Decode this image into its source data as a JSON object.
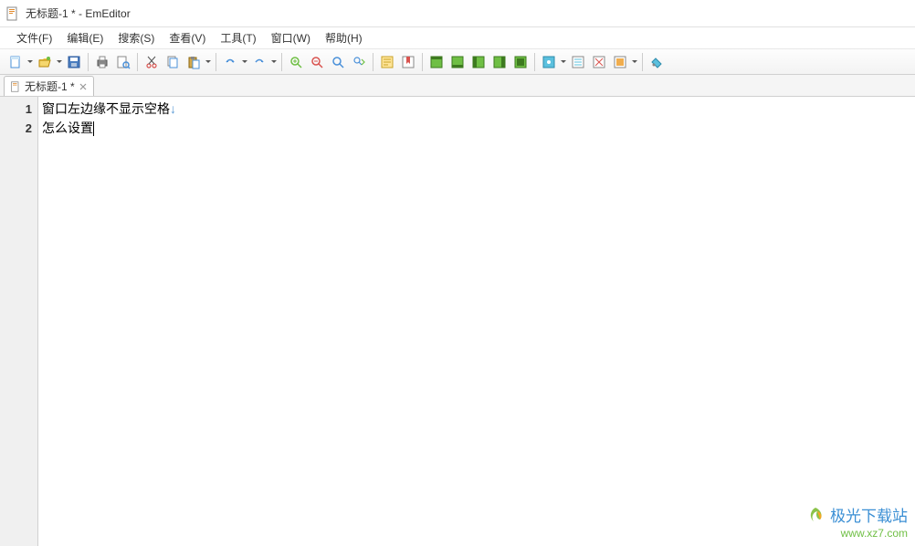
{
  "window": {
    "title": "无标题-1 * - EmEditor"
  },
  "menubar": {
    "items": [
      {
        "label": "文件(F)"
      },
      {
        "label": "编辑(E)"
      },
      {
        "label": "搜索(S)"
      },
      {
        "label": "查看(V)"
      },
      {
        "label": "工具(T)"
      },
      {
        "label": "窗口(W)"
      },
      {
        "label": "帮助(H)"
      }
    ]
  },
  "toolbar": {
    "icons": {
      "new": "new-file-icon",
      "open": "open-folder-icon",
      "save": "save-icon",
      "print": "print-icon",
      "preview": "print-preview-icon",
      "cut": "cut-icon",
      "copy": "copy-icon",
      "paste": "paste-icon",
      "undo": "undo-icon",
      "redo": "redo-icon",
      "zoomin": "zoom-in-icon",
      "zoomout": "zoom-out-icon",
      "find": "find-icon",
      "findnext": "find-next-icon",
      "wrap": "word-wrap-icon"
    }
  },
  "tabbar": {
    "tabs": [
      {
        "label": "无标题-1 *"
      }
    ]
  },
  "editor": {
    "lines": [
      {
        "num": "1",
        "text": "窗口左边缘不显示空格",
        "eol": "↓"
      },
      {
        "num": "2",
        "text": "怎么设置",
        "eol": ""
      }
    ]
  },
  "watermark": {
    "name": "极光下载站",
    "url": "www.xz7.com"
  }
}
